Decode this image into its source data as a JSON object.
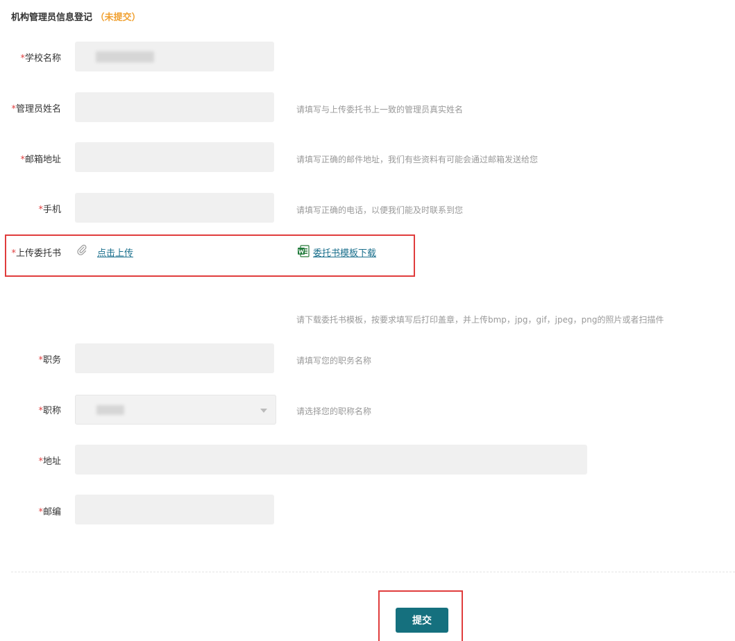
{
  "header": {
    "title": "机构管理员信息登记",
    "status_open": "（",
    "status": "未提交",
    "status_close": "）",
    "status_color": "#f0a030"
  },
  "required_mark": "*",
  "form": {
    "school_name": {
      "label": "学校名称",
      "value_redacted": true
    },
    "admin_name": {
      "label": "管理员姓名",
      "hint": "请填写与上传委托书上一致的管理员真实姓名"
    },
    "email": {
      "label": "邮箱地址",
      "hint": "请填写正确的邮件地址，我们有些资料有可能会通过邮箱发送给您"
    },
    "phone": {
      "label": "手机",
      "hint": "请填写正确的电话，以便我们能及时联系到您"
    },
    "upload": {
      "label": "上传委托书",
      "icon": "paperclip-icon",
      "upload_link": "点击上传",
      "template_icon": "word-doc-icon",
      "template_link": "委托书模板下载",
      "hint": "请下载委托书模板，按要求填写后打印盖章，并上传bmp，jpg，gif，jpeg，png的照片或者扫描件"
    },
    "position": {
      "label": "职务",
      "hint": "请填写您的职务名称"
    },
    "title": {
      "label": "职称",
      "hint": "请选择您的职称名称",
      "value_redacted": true,
      "icon": "chevron-down-icon"
    },
    "address": {
      "label": "地址"
    },
    "postcode": {
      "label": "邮编"
    }
  },
  "submit_label": "提交",
  "colors": {
    "accent": "#15707e",
    "required": "#e04040",
    "highlight_box": "#e03c3c",
    "field_bg": "#f0f0f0"
  }
}
